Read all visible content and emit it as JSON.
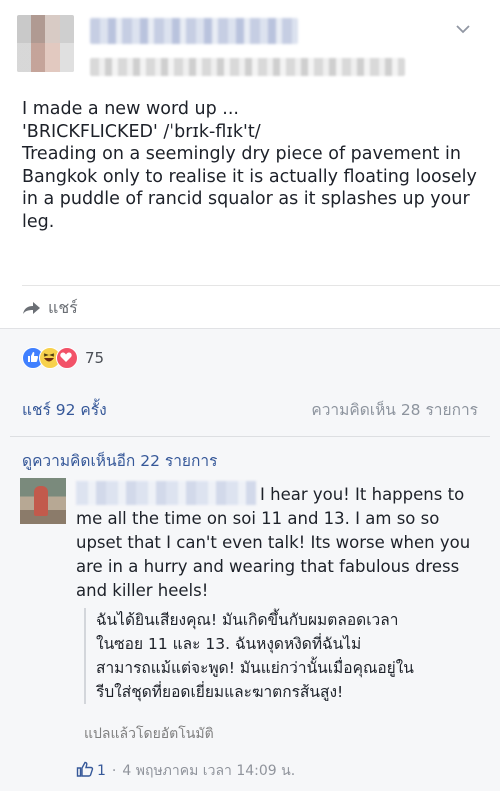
{
  "post": {
    "text": "I made a new word up ...\n'BRICKFLICKED' /ˈbrɪk-flɪk't/\nTreading on a seemingly dry piece of pavement in Bangkok only to realise it is actually floating loosely in a puddle of rancid squalor as it splashes up your leg.",
    "share_label": "แชร์"
  },
  "reactions": {
    "count": "75",
    "icons": [
      "like-icon",
      "haha-icon",
      "love-icon"
    ]
  },
  "stats": {
    "shares": "แชร์ 92 ครั้ง",
    "comments": "ความคิดเห็น 28 รายการ"
  },
  "comments": {
    "view_more": "ดูความคิดเห็นอีก 22 รายการ",
    "first": {
      "text_lead": "I hear you! It happens",
      "text_rest": "to me all the time on soi 11 and 13. I am so so upset that I can't even talk! Its worse when you are in a hurry and wearing that fabulous dress and killer heels!",
      "translation": "ฉันได้ยินเสียงคุณ! มันเกิดขึ้นกับผมตลอดเวลา\nในซอย 11 และ 13. ฉันหงุดหงิดที่ฉันไม่\nสามารถแม้แต่จะพูด! มันแย่กว่านั้นเมื่อคุณอยู่ใน\nรีบใส่ชุดที่ยอดเยี่ยมและฆาตกรส้นสูง!",
      "auto_translated_label": "แปลแล้วโดยอัตโนมัติ",
      "like_count": "1",
      "timestamp": "4 พฤษภาคม เวลา 14:09 น."
    }
  },
  "colors": {
    "link": "#365899",
    "muted": "#90949c",
    "band": "#f6f7f9"
  }
}
